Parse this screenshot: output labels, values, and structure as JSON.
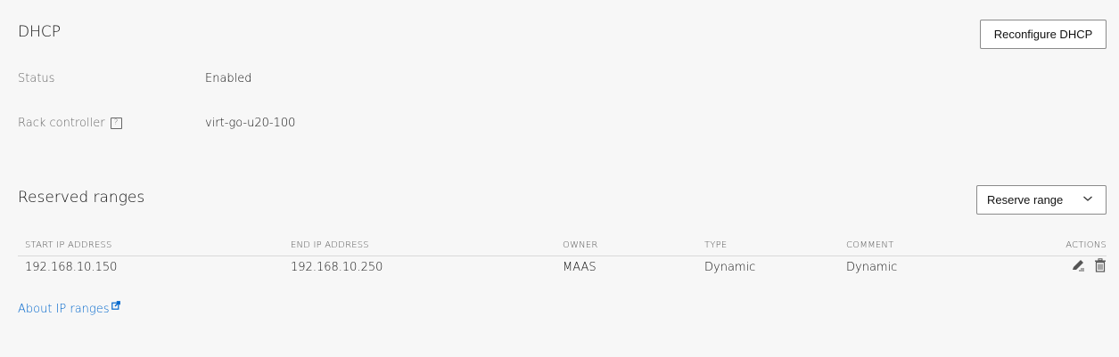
{
  "dhcp": {
    "title": "DHCP",
    "reconfigure_label": "Reconfigure DHCP",
    "status_label": "Status",
    "status_value": "Enabled",
    "rack_label": "Rack controller",
    "rack_value": "virt-go-u20-100",
    "help_icon": "help-icon"
  },
  "reserved": {
    "title": "Reserved ranges",
    "reserve_label": "Reserve range",
    "dropdown_icon": "chevron-down-icon",
    "columns": {
      "start": "START IP ADDRESS",
      "end": "END IP ADDRESS",
      "owner": "OWNER",
      "type": "TYPE",
      "comment": "COMMENT",
      "actions": "ACTIONS"
    },
    "rows": [
      {
        "start": "192.168.10.150",
        "end": "192.168.10.250",
        "owner": "MAAS",
        "type": "Dynamic",
        "comment": "Dynamic",
        "actions": [
          "edit-icon",
          "delete-icon"
        ]
      }
    ]
  },
  "links": {
    "about_label": "About IP ranges",
    "external_icon": "external-link-icon"
  },
  "colors": {
    "background": "#f7f7f7",
    "link": "#0066cc",
    "border": "#8a8a8a",
    "muted_text": "#666666"
  }
}
